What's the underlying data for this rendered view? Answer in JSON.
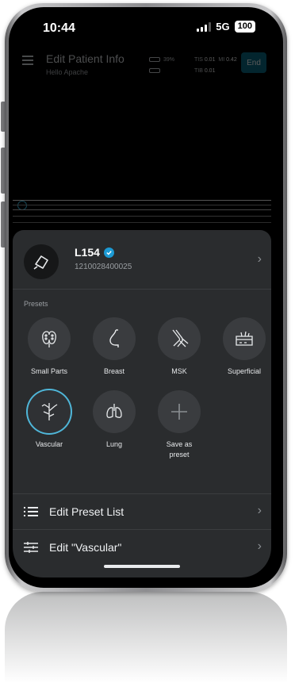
{
  "status_bar": {
    "time": "10:44",
    "network": "5G",
    "battery": "100"
  },
  "header": {
    "title": "Edit Patient Info",
    "subtitle": "Hello Apache",
    "battery_percent": "39%",
    "tis_label": "TIS",
    "tis_value": "0.01",
    "mi_label": "MI",
    "mi_value": "0.42",
    "tib_label": "TIB",
    "tib_value": "0.01",
    "end_label": "End"
  },
  "probe": {
    "name": "L154",
    "serial": "1210028400025",
    "icon": "probe-icon"
  },
  "presets": {
    "section_label": "Presets",
    "items": [
      {
        "label": "Small Parts",
        "icon": "thyroid-icon",
        "selected": false
      },
      {
        "label": "Breast",
        "icon": "breast-icon",
        "selected": false
      },
      {
        "label": "MSK",
        "icon": "knee-joint-icon",
        "selected": false
      },
      {
        "label": "Superficial",
        "icon": "skin-layer-icon",
        "selected": false
      },
      {
        "label": "Vascular",
        "icon": "vessel-icon",
        "selected": true
      },
      {
        "label": "Lung",
        "icon": "lungs-icon",
        "selected": false
      },
      {
        "label": "Save as\npreset",
        "icon": "plus-icon",
        "selected": false
      }
    ]
  },
  "menu": {
    "edit_preset_list": "Edit Preset List",
    "edit_current": "Edit  \"Vascular\""
  },
  "colors": {
    "accent": "#4fb6d8",
    "sheet_bg": "#2a2c2e",
    "end_button": "#0a6b84",
    "verified": "#1c9ad4"
  }
}
